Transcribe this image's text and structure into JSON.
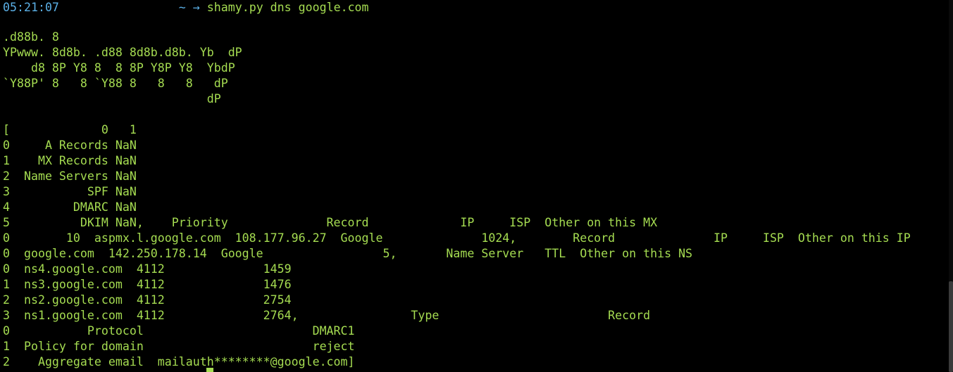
{
  "prompt": {
    "time": "05:21:07",
    "cwd": "~ →",
    "command": "shamy.py dns google.com"
  },
  "banner": [
    ".d88b. 8",
    "YPwww. 8d8b. .d88 8d8b.d8b. Yb  dP",
    "    d8 8P Y8 8  8 8P Y8P Y8  YbdP",
    "`Y88P' 8   8 `Y88 8   8   8   dP",
    "                             dP"
  ],
  "output": [
    "[             0   1",
    "0     A Records NaN",
    "1    MX Records NaN",
    "2  Name Servers NaN",
    "3           SPF NaN",
    "4         DMARC NaN",
    "5          DKIM NaN,    Priority              Record             IP     ISP  Other on this MX",
    "0        10  aspmx.l.google.com  108.177.96.27  Google              1024,        Record              IP     ISP  Other on this IP",
    "0  google.com  142.250.178.14  Google                 5,       Name Server   TTL  Other on this NS",
    "0  ns4.google.com  4112              1459",
    "1  ns3.google.com  4112              1476",
    "2  ns2.google.com  4112              2754",
    "3  ns1.google.com  4112              2764,                Type                        Record",
    "0           Protocol                        DMARC1",
    "1  Policy for domain                        reject",
    "2    Aggregate email  mailauth********@google.com]"
  ],
  "colors": {
    "background": "#000000",
    "text": "#a5dc51",
    "prompt": "#5bb0e6"
  }
}
